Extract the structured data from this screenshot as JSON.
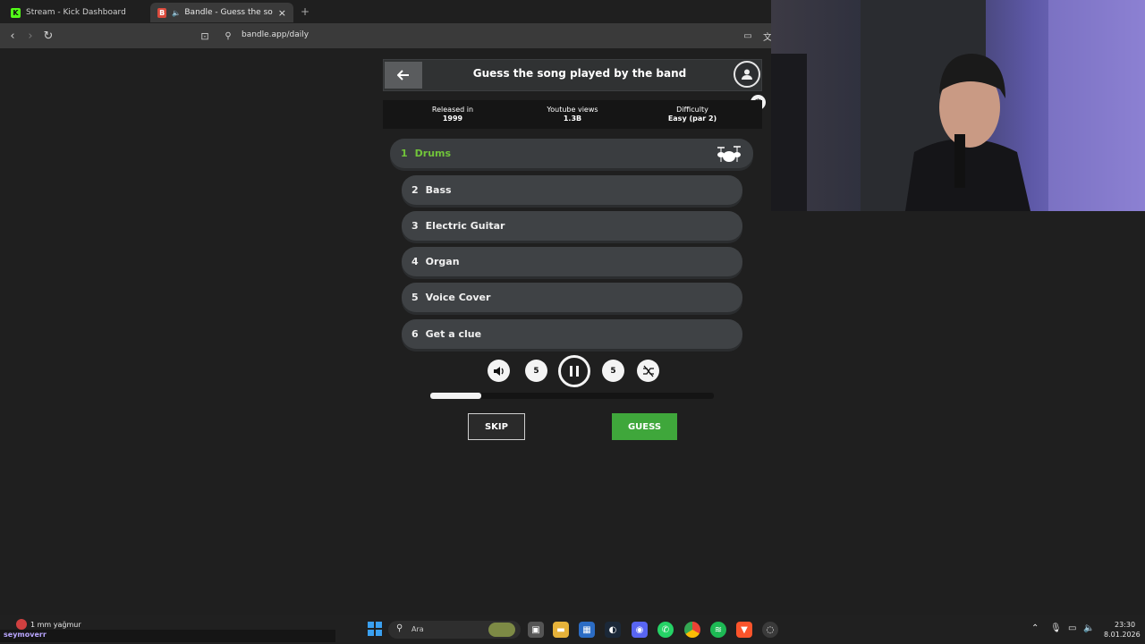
{
  "browser": {
    "tabs": [
      {
        "label": "Stream - Kick Dashboard",
        "icon": "kick-icon",
        "active": false
      },
      {
        "label": "Bandle - Guess the song, one",
        "icon": "bandle-icon",
        "active": true
      }
    ],
    "new_tab": "+",
    "close": "×",
    "url": "bandle.app/daily"
  },
  "game": {
    "title": "Guess the song played by the band",
    "stats": [
      {
        "label": "Released in",
        "value": "1999"
      },
      {
        "label": "Youtube views",
        "value": "1.3B"
      },
      {
        "label": "Difficulty",
        "value": "Easy (par 2)"
      }
    ],
    "instruments": [
      {
        "num": "1",
        "label": "Drums",
        "active": true
      },
      {
        "num": "2",
        "label": "Bass",
        "active": false
      },
      {
        "num": "3",
        "label": "Electric Guitar",
        "active": false
      },
      {
        "num": "4",
        "label": "Organ",
        "active": false
      },
      {
        "num": "5",
        "label": "Voice Cover",
        "active": false
      },
      {
        "num": "6",
        "label": "Get a clue",
        "active": false
      }
    ],
    "skip_back_label": "5",
    "skip_forward_label": "5",
    "progress": 0.18,
    "skip_label": "SKIP",
    "guess_label": "GUESS"
  },
  "taskbar": {
    "weather": "1 mm yağmur",
    "username": "seymoverr",
    "search_placeholder": "Ara",
    "time": "23:30",
    "date": "8.01.2026"
  },
  "colors": {
    "accent_green": "#3fa73b",
    "active_text": "#71c43a",
    "row_bg": "#3f4245"
  }
}
